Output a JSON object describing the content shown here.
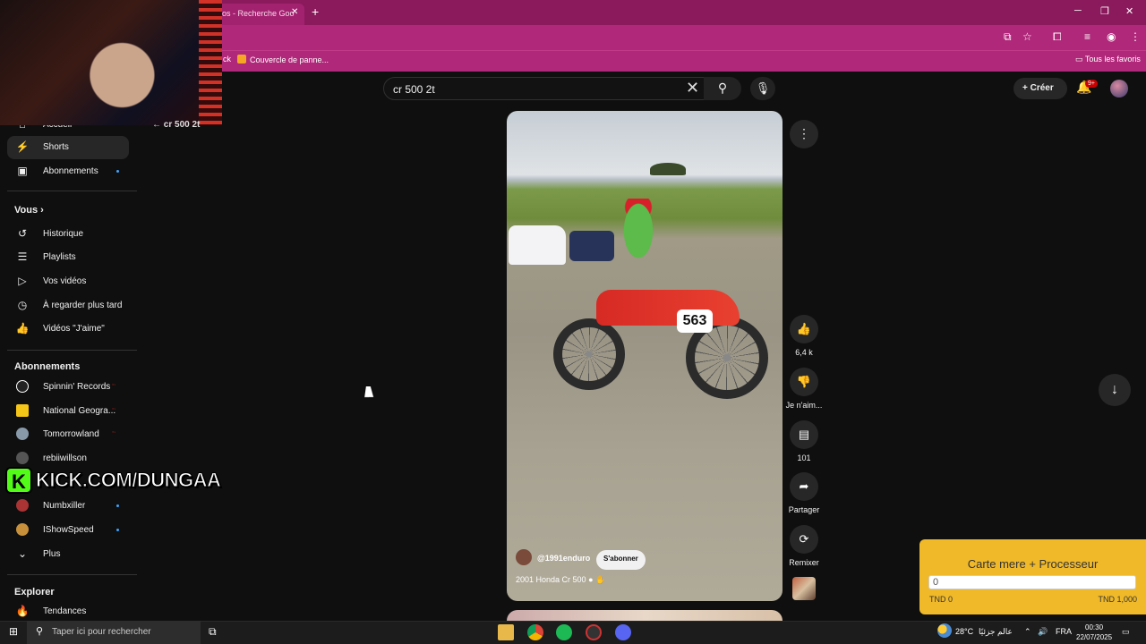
{
  "browser": {
    "tab_title": "os - Recherche Goo",
    "bookmarks": [
      {
        "label": "ck"
      },
      {
        "label": "Couvercle de panne..."
      }
    ],
    "all_favorites": "Tous les favoris"
  },
  "youtube": {
    "search_value": "cr 500 2t",
    "create_label": "Créer",
    "notification_badge": "9+",
    "back_title": "cr 500 2t"
  },
  "sidebar": {
    "main_items": [
      {
        "label": "Accueil"
      },
      {
        "label": "Shorts"
      },
      {
        "label": "Abonnements"
      }
    ],
    "you_title": "Vous",
    "you_items": [
      {
        "label": "Historique"
      },
      {
        "label": "Playlists"
      },
      {
        "label": "Vos vidéos"
      },
      {
        "label": "À regarder plus tard"
      },
      {
        "label": "Vidéos \"J'aime\""
      }
    ],
    "subs_title": "Abonnements",
    "subs_items": [
      {
        "label": "Spinnin' Records",
        "color": "#ffffff"
      },
      {
        "label": "National Geogra...",
        "color": "#f5c518"
      },
      {
        "label": "Tomorrowland",
        "color": "#8899aa"
      },
      {
        "label": "rebiiwillson",
        "color": "#555555"
      },
      {
        "label": "Numbxiller",
        "color": "#aa3333"
      },
      {
        "label": "IShowSpeed",
        "color": "#c8903a"
      }
    ],
    "more_label": "Plus",
    "explore_title": "Explorer",
    "explore_items": [
      {
        "label": "Tendances"
      }
    ]
  },
  "overlay": {
    "kick_text": "KICK.COM/DUNGAA",
    "kick_logo": "K"
  },
  "short": {
    "channel": "@1991enduro",
    "subscribe_label": "S'abonner",
    "title": "2001 Honda Cr 500",
    "plate_number": "563",
    "likes": "6,4 k",
    "dislike_label": "Je n'aim...",
    "comments": "101",
    "share_label": "Partager",
    "remix_label": "Remixer"
  },
  "donation": {
    "title": "Carte mere + Processeur",
    "current": "0",
    "min_label": "TND 0",
    "max_label": "TND 1,000",
    "accent": "#f0b92a"
  },
  "taskbar": {
    "search_placeholder": "Taper ici pour rechercher",
    "weather": "28°C",
    "weather_text": "عالم جزئيًا",
    "language": "FRA",
    "time": "00:30",
    "date": "22/07/2025"
  }
}
